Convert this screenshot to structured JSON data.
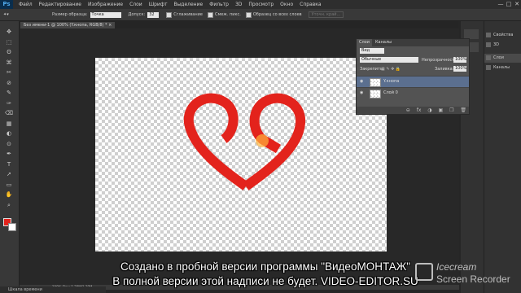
{
  "menu": {
    "logo": "Ps",
    "items": [
      "Файл",
      "Редактирование",
      "Изображение",
      "Слои",
      "Шрифт",
      "Выделение",
      "Фильтр",
      "3D",
      "Просмотр",
      "Окно",
      "Справка"
    ],
    "window_buttons": [
      "—",
      "□",
      "✕"
    ]
  },
  "options": {
    "size_label": "Размер образца:",
    "size_value": "Точка",
    "tolerance_label": "Допуск:",
    "tolerance_value": "32",
    "antialias": "Сглаживание",
    "contiguous": "Смеж. пикс.",
    "all_layers": "Образец со всех слоев",
    "refine_edge": "Уточн. край..."
  },
  "document": {
    "tab_title": "Без имени-1 @ 100% (Y.кнопа, RGB/8) *",
    "status": "100%   Док: 1,38М/1,38М"
  },
  "tools": [
    "✥",
    "⬚",
    "ʘ",
    "⌘",
    "✂",
    "⊘",
    "✎",
    "✑",
    "⌫",
    "▦",
    "◐",
    "⊙",
    "✒",
    "T",
    "➚",
    "▭",
    "✋",
    "⌕"
  ],
  "timeline": "Шкала времени",
  "right_panels": {
    "group1": [
      "Свойства",
      "3D"
    ],
    "group2": [
      "Слои",
      "Каналы"
    ]
  },
  "layers_panel": {
    "tabs": [
      "Слои",
      "Каналы"
    ],
    "kind_filter": "Вид",
    "blend_mode": "Обычные",
    "opacity_label": "Непрозрачность:",
    "opacity_value": "100%",
    "lock_label": "Закрепить:",
    "fill_label": "Заливка:",
    "fill_value": "100%",
    "layers": [
      {
        "name": "Y.кнопа",
        "visible": true,
        "selected": true
      },
      {
        "name": "Слой 0",
        "visible": true,
        "selected": false
      }
    ],
    "bottom_icons": [
      "⊖",
      "fx",
      "◑",
      "▣",
      "❐",
      "🗑"
    ]
  },
  "heart_color": "#e3231c",
  "watermark": {
    "line1": "Создано в пробной версии программы \"ВидеоМОНТАЖ\"",
    "line2": "В полной версии этой надписи не будет. VIDEO-EDITOR.SU"
  },
  "recorder": {
    "brand": "Icecream",
    "sub": "Screen Recorder"
  }
}
